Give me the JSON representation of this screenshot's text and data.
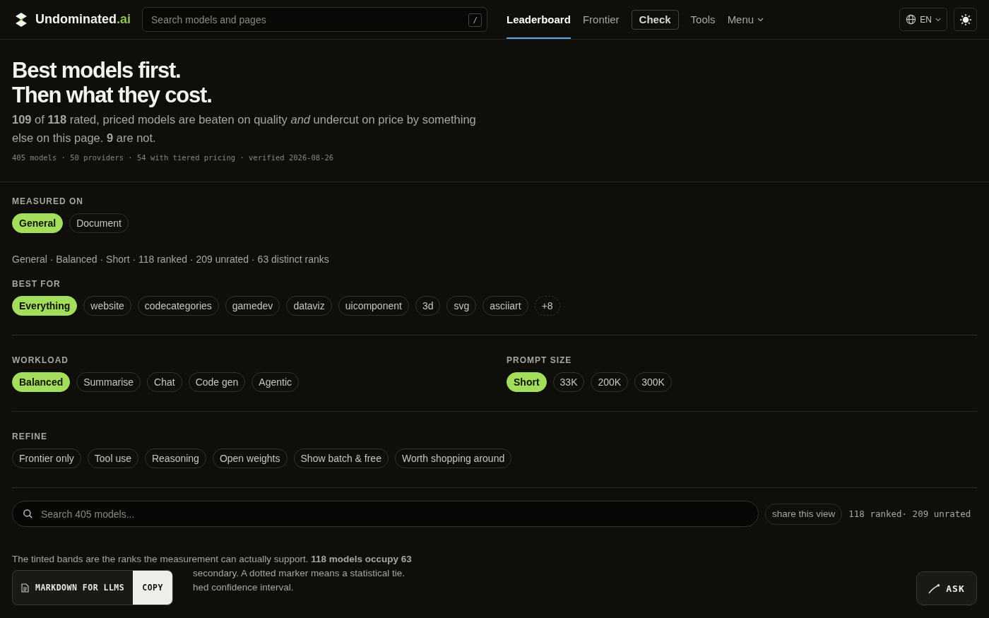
{
  "header": {
    "brand": "Undominated",
    "brand_suffix": ".ai",
    "search": {
      "placeholder": "Search models and pages",
      "shortcut": "/"
    },
    "nav": [
      {
        "label": "Leaderboard",
        "kind": "link",
        "selected": true
      },
      {
        "label": "Frontier",
        "kind": "link",
        "selected": false
      },
      {
        "label": "Check",
        "kind": "boxed",
        "selected": false
      },
      {
        "label": "Tools",
        "kind": "link",
        "selected": false
      },
      {
        "label": "Menu",
        "kind": "menu",
        "selected": false
      }
    ],
    "language": "EN"
  },
  "hero": {
    "title_lines": [
      "Best models first.",
      "Then what they cost."
    ],
    "summary": "**109** of **118** rated, priced models are beaten on quality *and* undercut on price by something else on this page. **9** are not.",
    "meta": "405 models · 50 providers · 54 with tiered pricing · verified 2026-08-26"
  },
  "measured_on": {
    "label": "MEASURED ON",
    "options": [
      {
        "label": "General",
        "selected": true
      },
      {
        "label": "Document",
        "selected": false
      }
    ],
    "summary": "General · Balanced · Short · 118 ranked · 209 unrated · 63 distinct ranks"
  },
  "best_for": {
    "label": "BEST FOR",
    "options": [
      {
        "label": "Everything",
        "selected": true
      },
      {
        "label": "website",
        "selected": false
      },
      {
        "label": "codecategories",
        "selected": false
      },
      {
        "label": "gamedev",
        "selected": false
      },
      {
        "label": "dataviz",
        "selected": false
      },
      {
        "label": "uicomponent",
        "selected": false
      },
      {
        "label": "3d",
        "selected": false
      },
      {
        "label": "svg",
        "selected": false
      },
      {
        "label": "asciiart",
        "selected": false
      }
    ],
    "more": "+8"
  },
  "workload": {
    "label": "WORKLOAD",
    "options": [
      {
        "label": "Balanced",
        "selected": true
      },
      {
        "label": "Summarise",
        "selected": false
      },
      {
        "label": "Chat",
        "selected": false
      },
      {
        "label": "Code gen",
        "selected": false
      },
      {
        "label": "Agentic",
        "selected": false
      }
    ]
  },
  "prompt_size": {
    "label": "PROMPT SIZE",
    "options": [
      {
        "label": "Short",
        "selected": true
      },
      {
        "label": "33K",
        "selected": false
      },
      {
        "label": "200K",
        "selected": false
      },
      {
        "label": "300K",
        "selected": false
      }
    ]
  },
  "refine": {
    "label": "REFINE",
    "options": [
      {
        "label": "Frontier only",
        "selected": false
      },
      {
        "label": "Tool use",
        "selected": false
      },
      {
        "label": "Reasoning",
        "selected": false
      },
      {
        "label": "Open weights",
        "selected": false
      },
      {
        "label": "Show batch & free",
        "selected": false
      },
      {
        "label": "Worth shopping around",
        "selected": false
      }
    ]
  },
  "model_search": {
    "placeholder": "Search 405 models...",
    "share": "share this view",
    "counts": "118 ranked· 209 unrated"
  },
  "note_lines": [
    "The tinted bands are the ranks the measurement can actually support. **118 models occupy 63**",
    "secondary. A dotted marker means a statistical tie.",
    "hed confidence interval."
  ],
  "markdown_bar": {
    "label": "MARKDOWN FOR LLMS",
    "copy": "COPY"
  },
  "ask_button": "ASK"
}
